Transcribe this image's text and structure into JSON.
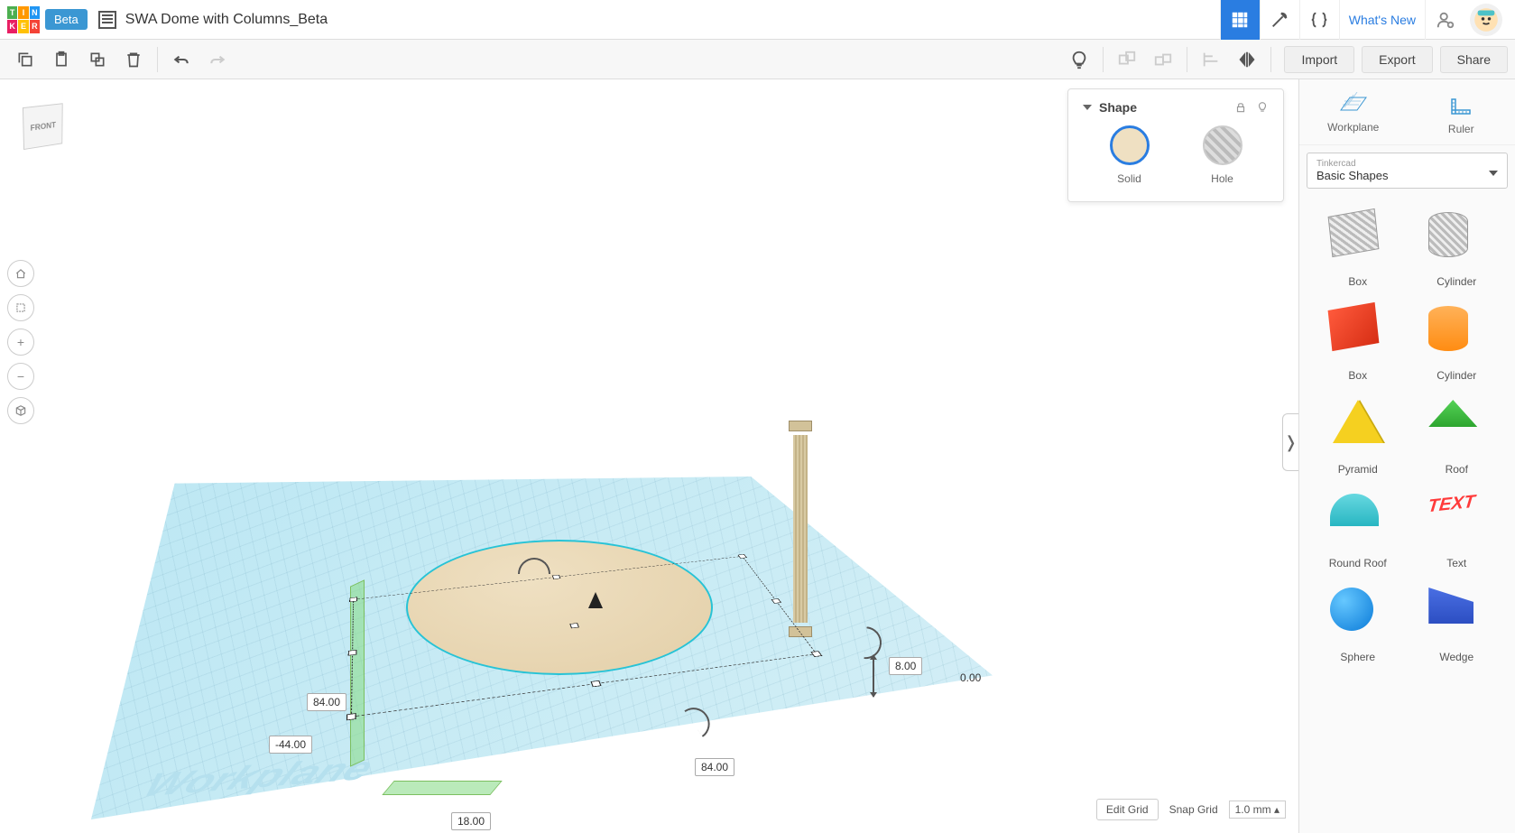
{
  "header": {
    "beta_label": "Beta",
    "doc_title": "SWA Dome with Columns_Beta",
    "whats_new": "What's New",
    "logo_letters": [
      "T",
      "I",
      "N",
      "K",
      "E",
      "R"
    ]
  },
  "toolbar_right": {
    "import": "Import",
    "export": "Export",
    "share": "Share"
  },
  "viewcube": {
    "face": "FRONT"
  },
  "shape_panel": {
    "title": "Shape",
    "solid": "Solid",
    "hole": "Hole"
  },
  "dimensions": {
    "width": "84.00",
    "depth": "84.00",
    "offset_x": "-44.00",
    "offset_y": "18.00",
    "height": "8.00",
    "z": "0.00"
  },
  "sidebar": {
    "workplane": "Workplane",
    "ruler": "Ruler",
    "library_source": "Tinkercad",
    "library_name": "Basic Shapes",
    "shapes": [
      {
        "label": "Box"
      },
      {
        "label": "Cylinder"
      },
      {
        "label": "Box"
      },
      {
        "label": "Cylinder"
      },
      {
        "label": "Pyramid"
      },
      {
        "label": "Roof"
      },
      {
        "label": "Round Roof"
      },
      {
        "label": "Text"
      },
      {
        "label": "Sphere"
      },
      {
        "label": "Wedge"
      }
    ]
  },
  "bottom": {
    "edit_grid": "Edit Grid",
    "snap_label": "Snap Grid",
    "snap_value": "1.0 mm"
  },
  "workplane_label": "Workplane"
}
